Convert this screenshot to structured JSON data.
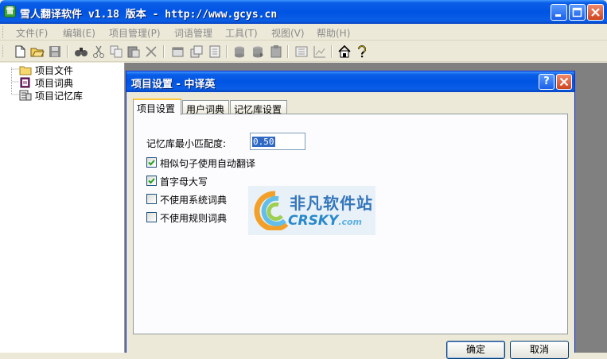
{
  "window": {
    "title": "雪人翻译软件 v1.18 版本 - http://www.gcys.cn",
    "app_icon_text": "雪"
  },
  "menu": [
    "文件(F)",
    "编辑(E)",
    "项目管理(P)",
    "词语管理",
    "工具(T)",
    "视图(V)",
    "帮助(H)"
  ],
  "toolbar_icons": [
    "new-file-icon",
    "open-folder-icon",
    "save-icon",
    "find-icon",
    "cut-icon",
    "copy-icon",
    "paste-icon",
    "delete-icon",
    "icon-5",
    "icon-6",
    "icon-7",
    "icon-8",
    "icon-9",
    "icon-10",
    "icon-11",
    "icon-12",
    "home-icon",
    "help-icon"
  ],
  "tree": [
    {
      "label": "项目文件",
      "icon": "folder-icon"
    },
    {
      "label": "项目词典",
      "icon": "dictionary-icon"
    },
    {
      "label": "项目记忆库",
      "icon": "memory-icon"
    }
  ],
  "dialog": {
    "title": "项目设置 - 中译英",
    "help_button": "?",
    "tabs": [
      "项目设置",
      "用户词典",
      "记忆库设置"
    ],
    "active_tab": 0,
    "memory_match_label": "记忆库最小匹配度:",
    "memory_match_value": "0.50",
    "options": [
      {
        "label": "相似句子使用自动翻译",
        "checked": true
      },
      {
        "label": "首字母大写",
        "checked": true
      },
      {
        "label": "不使用系统词典",
        "checked": false
      },
      {
        "label": "不使用规则词典",
        "checked": false
      }
    ],
    "ok_label": "确定",
    "cancel_label": "取消"
  },
  "watermark": {
    "cn": "非凡软件站",
    "en": "CRSKY",
    "en_suffix": ".com"
  }
}
